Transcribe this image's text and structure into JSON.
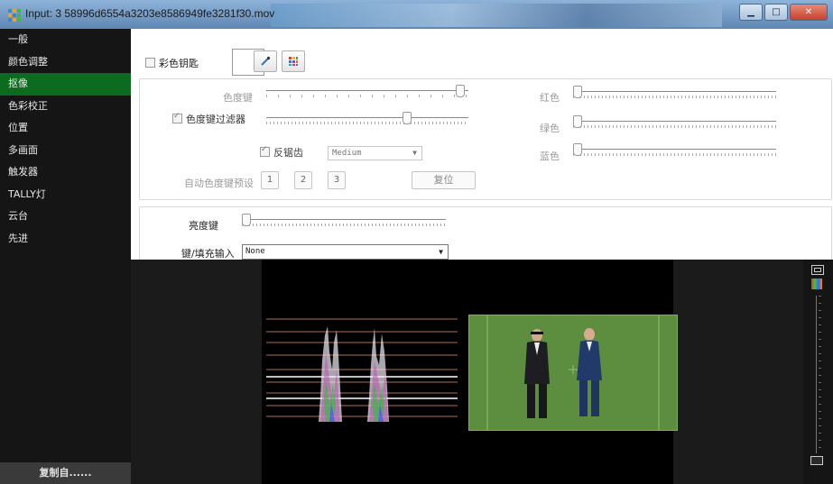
{
  "window": {
    "title": "Input: 3 58996d6554a3203e8586949fe3281f30.mov",
    "buttons": {
      "minimize": "▁",
      "maximize": "□",
      "close": "✕"
    }
  },
  "sidebar": {
    "items": [
      {
        "label": "一般"
      },
      {
        "label": "颜色调整"
      },
      {
        "label": "抠像",
        "active": true
      },
      {
        "label": "色彩校正"
      },
      {
        "label": "位置"
      },
      {
        "label": "多画面"
      },
      {
        "label": "触发器"
      },
      {
        "label": "TALLY灯"
      },
      {
        "label": "云台"
      },
      {
        "label": "先进"
      }
    ],
    "copy_button": "复制自......"
  },
  "chroma": {
    "enable_label": "彩色钥匙",
    "key_label": "色度键",
    "filter_label": "色度键过滤器",
    "antialias_label": "反锯齿",
    "antialias_value": "Medium",
    "auto_preset_label": "自动色度键预设",
    "presets": [
      "1",
      "2",
      "3"
    ],
    "reset_label": "复位",
    "red_label": "红色",
    "green_label": "绿色",
    "blue_label": "蓝色",
    "key_level": 0.97,
    "filter_level": 0.7,
    "red_level": 0.0,
    "green_level": 0.0,
    "blue_level": 0.0
  },
  "luma": {
    "key_label": "亮度键",
    "key_level": 0.0,
    "fill_input_label": "键/填充输入",
    "fill_input_value": "None"
  },
  "colors": {
    "active_tab": "#0d6b1f",
    "chroma_green": "#5d8e3f"
  }
}
